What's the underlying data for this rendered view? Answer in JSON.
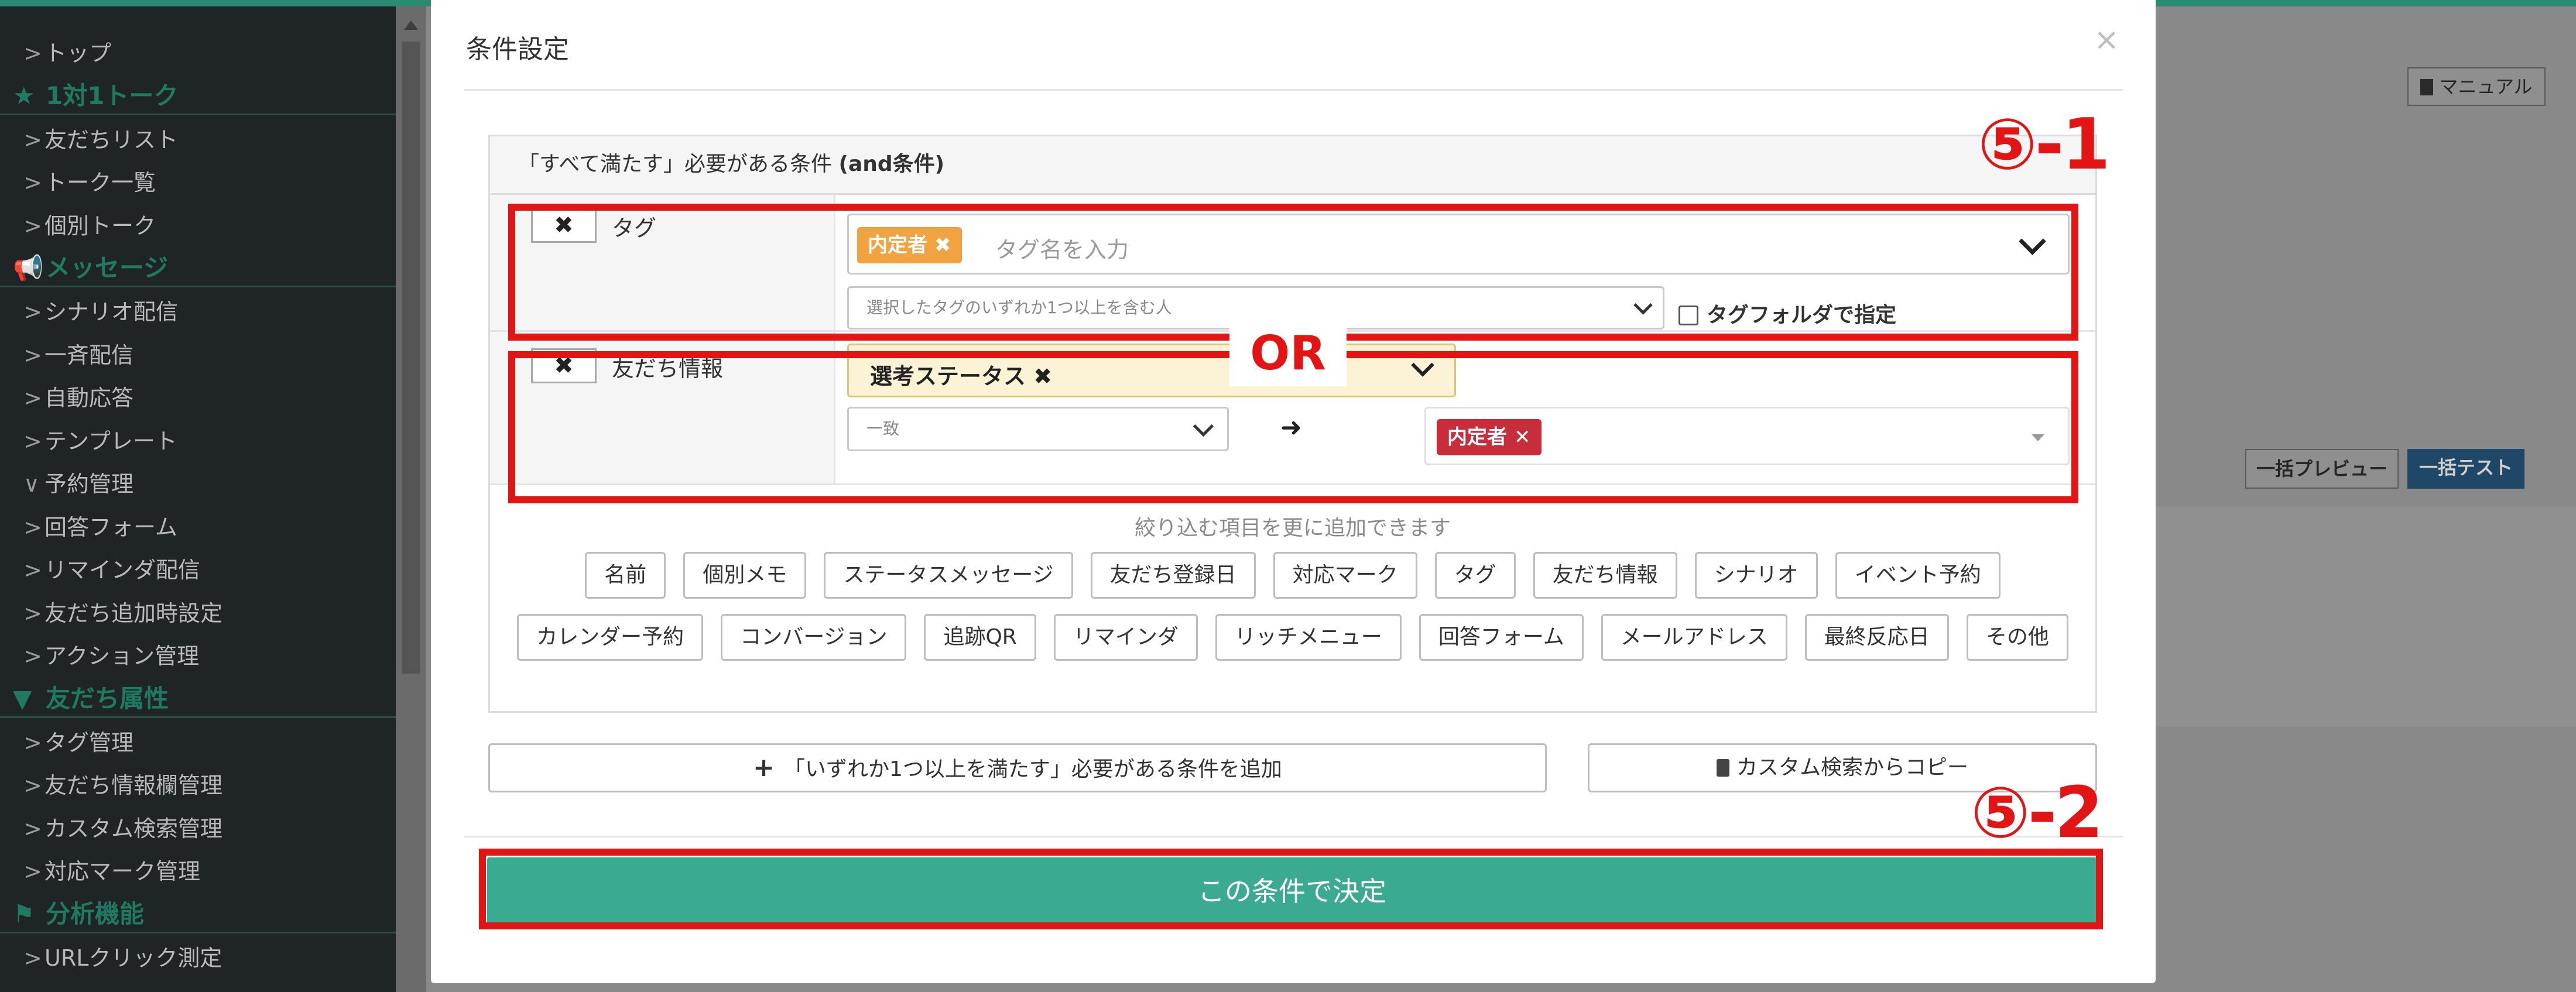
{
  "sidebar": {
    "items": [
      {
        "kind": "item",
        "label": "トップ",
        "chev": ">"
      },
      {
        "kind": "section",
        "label": "1対1トーク",
        "icon": "★"
      },
      {
        "kind": "item",
        "label": "友だちリスト",
        "chev": ">"
      },
      {
        "kind": "item",
        "label": "トーク一覧",
        "chev": ">"
      },
      {
        "kind": "item",
        "label": "個別トーク",
        "chev": ">"
      },
      {
        "kind": "section",
        "label": "メッセージ",
        "icon": "📢"
      },
      {
        "kind": "item",
        "label": "シナリオ配信",
        "chev": ">"
      },
      {
        "kind": "item",
        "label": "一斉配信",
        "chev": ">"
      },
      {
        "kind": "item",
        "label": "自動応答",
        "chev": ">"
      },
      {
        "kind": "item",
        "label": "テンプレート",
        "chev": ">"
      },
      {
        "kind": "item",
        "label": "予約管理",
        "chev": "∨"
      },
      {
        "kind": "item",
        "label": "回答フォーム",
        "chev": ">"
      },
      {
        "kind": "item",
        "label": "リマインダ配信",
        "chev": ">"
      },
      {
        "kind": "item",
        "label": "友だち追加時設定",
        "chev": ">"
      },
      {
        "kind": "item",
        "label": "アクション管理",
        "chev": ">"
      },
      {
        "kind": "section",
        "label": "友だち属性",
        "icon": "▼"
      },
      {
        "kind": "item",
        "label": "タグ管理",
        "chev": ">"
      },
      {
        "kind": "item",
        "label": "友だち情報欄管理",
        "chev": ">"
      },
      {
        "kind": "item",
        "label": "カスタム検索管理",
        "chev": ">"
      },
      {
        "kind": "item",
        "label": "対応マーク管理",
        "chev": ">"
      },
      {
        "kind": "section",
        "label": "分析機能",
        "icon": "⚑"
      },
      {
        "kind": "item",
        "label": "URLクリック測定",
        "chev": ">"
      }
    ]
  },
  "background": {
    "manual_label": "マニュアル",
    "preview_label": "一括プレビュー",
    "test_label": "一括テスト"
  },
  "modal": {
    "title": "条件設定",
    "close": "×",
    "and_header_prefix": "「すべて満たす」必要がある条件 ",
    "and_header_bold": "(and条件)",
    "tag_row": {
      "remove": "✖",
      "label": "タグ",
      "chip": "内定者",
      "chip_x": "✖",
      "placeholder": "タグ名を入力",
      "match_mode": "選択したタグのいずれか1つ以上を含む人",
      "folder_checkbox_label": "タグフォルダで指定"
    },
    "friend_row": {
      "remove": "✖",
      "label": "友だち情報",
      "field": "選考ステータス",
      "field_x": "✖",
      "operator": "一致",
      "arrow": "➜",
      "value_chip": "内定者",
      "value_chip_x": "✕"
    },
    "hint": "絞り込む項目を更に追加できます",
    "pills_row1": [
      "名前",
      "個別メモ",
      "ステータスメッセージ",
      "友だち登録日",
      "対応マーク",
      "タグ",
      "友だち情報",
      "シナリオ",
      "イベント予約"
    ],
    "pills_row2": [
      "カレンダー予約",
      "コンバージョン",
      "追跡QR",
      "リマインダ",
      "リッチメニュー",
      "回答フォーム",
      "メールアドレス",
      "最終反応日",
      "その他"
    ],
    "add_or_button": "「いずれか1つ以上を満たす」必要がある条件を追加",
    "add_or_plus": "+",
    "copy_button": "カスタム検索からコピー",
    "submit": "この条件で決定"
  },
  "annotations": {
    "label_1": "⑤-1",
    "label_2": "⑤-2",
    "or": "OR",
    "color": "#e31414"
  }
}
